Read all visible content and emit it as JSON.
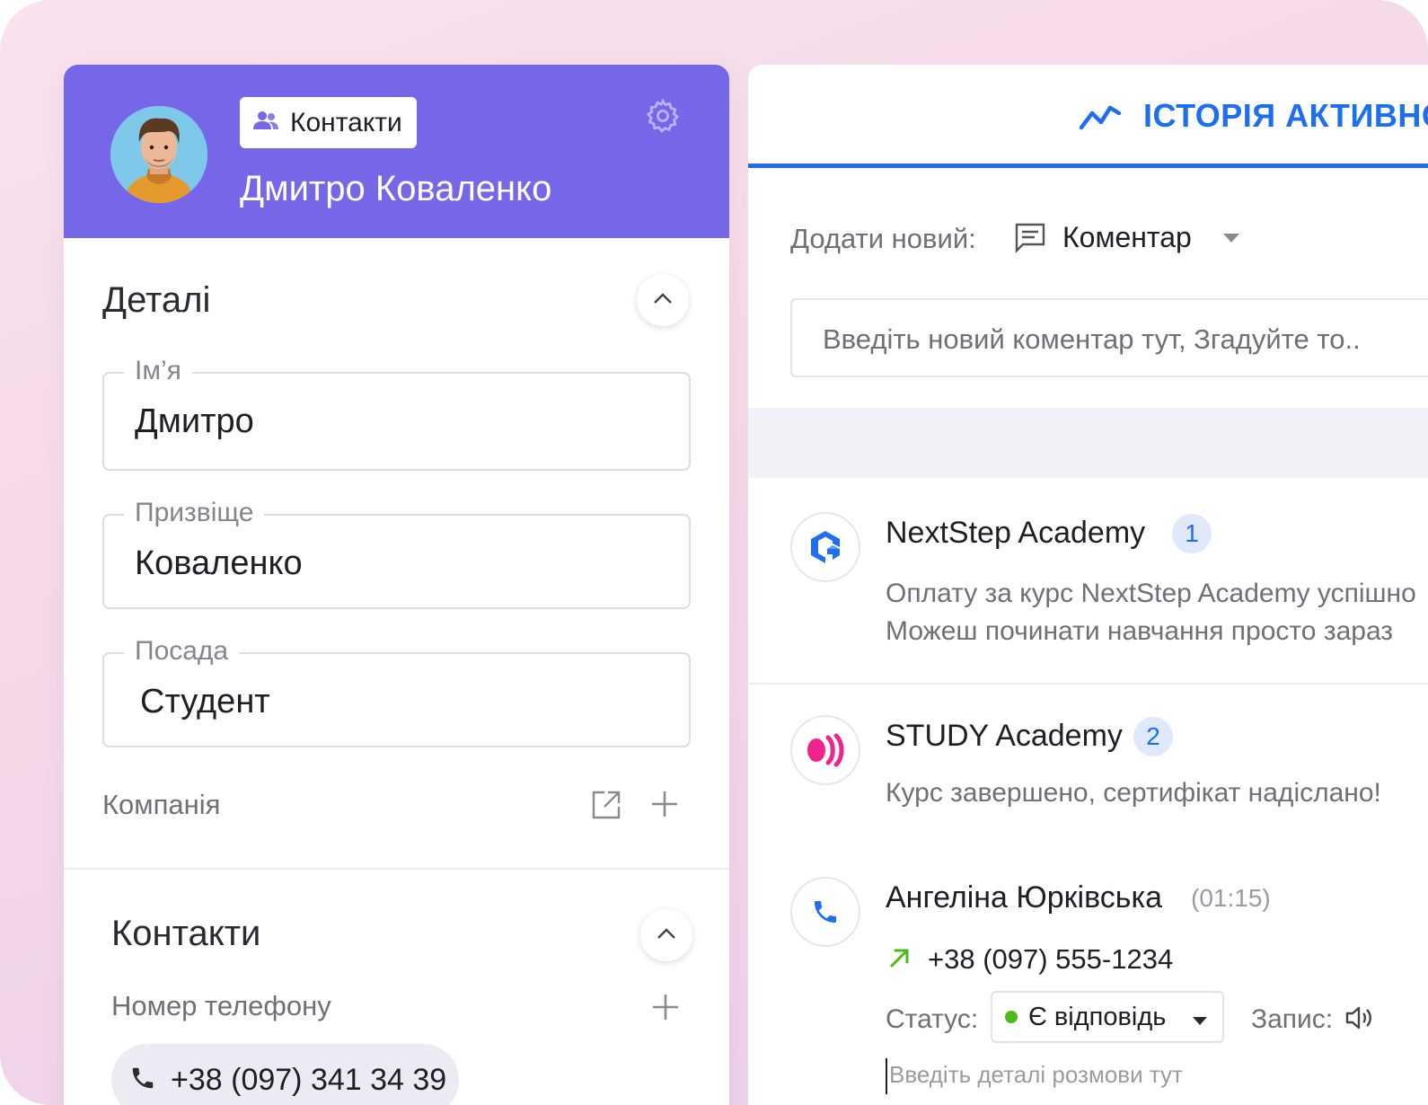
{
  "header": {
    "badge_label": "Контакти",
    "contact_name": "Дмитро Коваленко"
  },
  "details": {
    "title": "Деталі",
    "first_name": {
      "label": "Ім’я",
      "value": "Дмитро"
    },
    "last_name": {
      "label": "Призвіще",
      "value": "Коваленко"
    },
    "position": {
      "label": "Посада",
      "value": "Студент"
    },
    "company_label": "Компанія"
  },
  "contacts": {
    "title": "Контакти",
    "phone_label": "Номер телефону",
    "phone_value": "+38 (097) 341 34 39"
  },
  "activity": {
    "tab_title": "ІСТОРІЯ АКТИВНОСТІ",
    "add_label": "Додати новий:",
    "add_type": "Коментар",
    "comment_placeholder": "Введіть новий коментар тут, Згадуйте то.."
  },
  "feed": [
    {
      "title": "NextStep Academy",
      "count": "1",
      "lines": [
        "Оплату за курс NextStep Academy успішно",
        "Можеш починати навчання просто зараз"
      ]
    },
    {
      "title": "STUDY Academy",
      "count": "2",
      "lines": [
        "Курс завершено, сертифікат надіслано!"
      ]
    }
  ],
  "call": {
    "name": "Ангеліна Юрківська",
    "duration": "(01:15)",
    "phone": "+38 (097) 555-1234",
    "status_label": "Статус:",
    "status_value": "Є відповідь",
    "record_label": "Запис:",
    "details_placeholder": "Введіть деталі розмови тут"
  },
  "colors": {
    "header_bg": "#7667e8",
    "accent_blue": "#1e6ef0",
    "status_green": "#4cbb17",
    "study_pink": "#f0248c"
  }
}
